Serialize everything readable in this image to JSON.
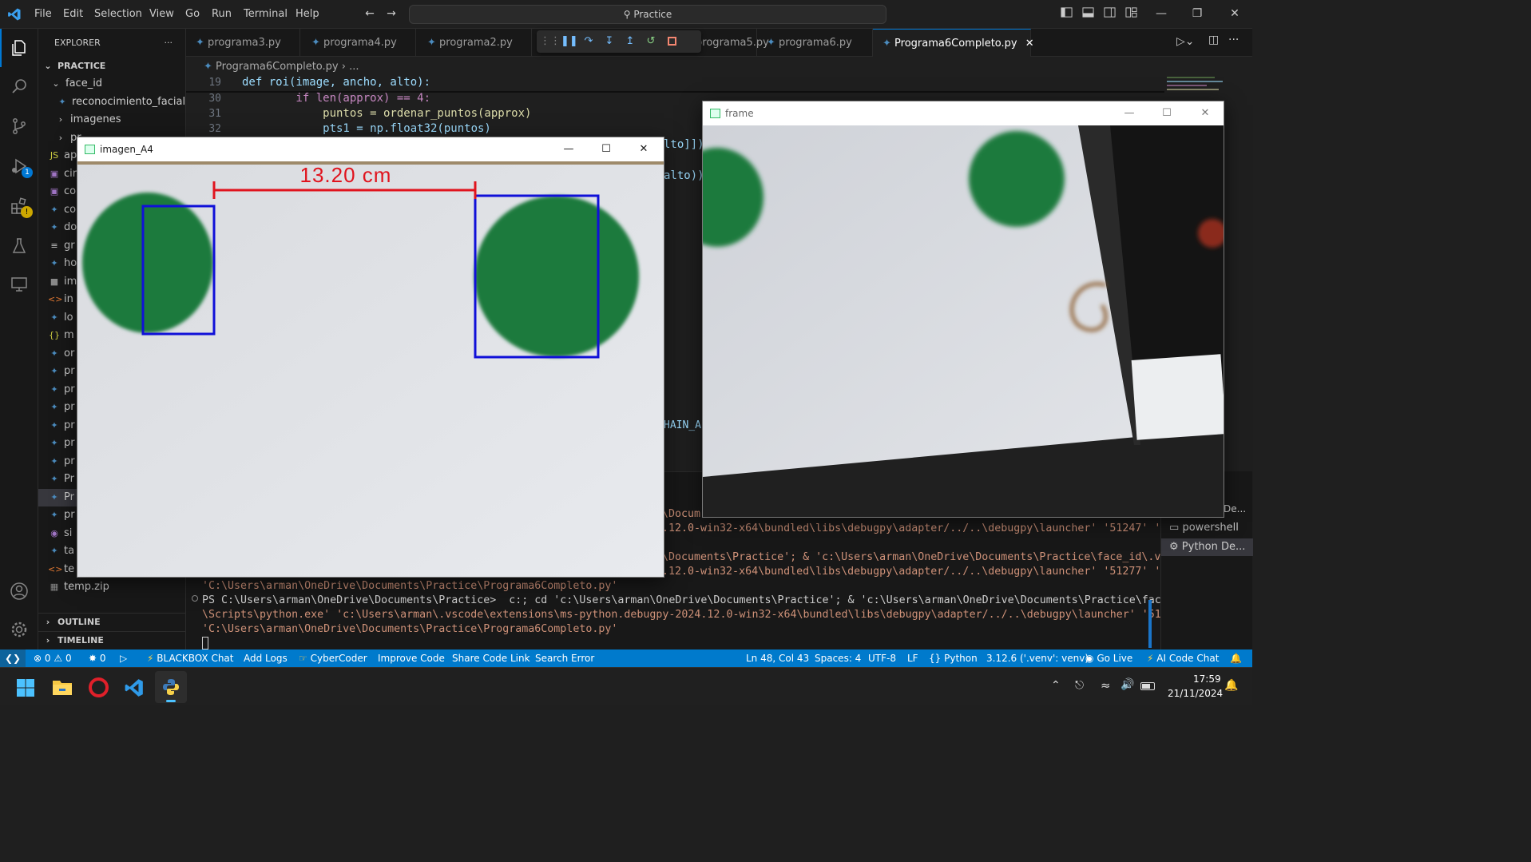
{
  "titlebar": {
    "menu": [
      "File",
      "Edit",
      "Selection",
      "View",
      "Go",
      "Run",
      "Terminal",
      "Help"
    ],
    "search_text": "Practice"
  },
  "explorer": {
    "header": "EXPLORER",
    "root": "PRACTICE",
    "items": [
      {
        "label": "face_id",
        "kind": "folder-open"
      },
      {
        "label": "reconocimiento_facial....",
        "kind": "py"
      },
      {
        "label": "imagenes",
        "kind": "folder"
      },
      {
        "label": "pr",
        "kind": "folder"
      },
      {
        "label": "ap",
        "kind": "js"
      },
      {
        "label": "cir",
        "kind": "img"
      },
      {
        "label": "co",
        "kind": "img"
      },
      {
        "label": "co",
        "kind": "py"
      },
      {
        "label": "do",
        "kind": "py"
      },
      {
        "label": "gr",
        "kind": "txt"
      },
      {
        "label": "ho",
        "kind": "py"
      },
      {
        "label": "im",
        "kind": "file"
      },
      {
        "label": "in",
        "kind": "html"
      },
      {
        "label": "lo",
        "kind": "py"
      },
      {
        "label": "m",
        "kind": "json"
      },
      {
        "label": "or",
        "kind": "py"
      },
      {
        "label": "pr",
        "kind": "py"
      },
      {
        "label": "pr",
        "kind": "py"
      },
      {
        "label": "pr",
        "kind": "py"
      },
      {
        "label": "pr",
        "kind": "py"
      },
      {
        "label": "pr",
        "kind": "py"
      },
      {
        "label": "pr",
        "kind": "py"
      },
      {
        "label": "Pr",
        "kind": "py"
      },
      {
        "label": "Pr",
        "kind": "py"
      },
      {
        "label": "pr",
        "kind": "py"
      },
      {
        "label": "si",
        "kind": "git"
      },
      {
        "label": "ta",
        "kind": "py"
      },
      {
        "label": "te",
        "kind": "html"
      },
      {
        "label": "temp.zip",
        "kind": "zip"
      }
    ],
    "outline": "OUTLINE",
    "timeline": "TIMELINE"
  },
  "tabs": [
    "programa3.py",
    "programa4.py",
    "programa2.py",
    "programa5.py",
    "programa6.py",
    "Programa6Completo.py"
  ],
  "breadcrumb": {
    "file": "Programa6Completo.py",
    "rest": "..."
  },
  "code": [
    {
      "num": "19",
      "text": "def roi(image, ancho, alto):"
    },
    {
      "num": "30",
      "text": "        if len(approx) == 4:"
    },
    {
      "num": "31",
      "text": "            puntos = ordenar_puntos(approx)"
    },
    {
      "num": "32",
      "text": "            pts1 = np.float32(puntos)"
    }
  ],
  "code_fragments": {
    "f1": "lto]])",
    "f2": "alto))",
    "f3": "HAIN_A"
  },
  "terminal": {
    "lines": [
      "\\Docum",
      ".12.0-win32-x64\\bundled\\libs\\debugpy\\adapter/../..\\debugpy\\launcher' '51247' '--'",
      "\\Documents\\Practice'; & 'c:\\Users\\arman\\OneDrive\\Documents\\Practice\\face_id\\.venv",
      ".12.0-win32-x64\\bundled\\libs\\debugpy\\adapter/../..\\debugpy\\launcher' '51277' '--'",
      "'C:\\Users\\arman\\OneDrive\\Documents\\Practice\\Programa6Completo.py'",
      "PS C:\\Users\\arman\\OneDrive\\Documents\\Practice>  c:; cd 'c:\\Users\\arman\\OneDrive\\Documents\\Practice'; & 'c:\\Users\\arman\\OneDrive\\Documents\\Practice\\face_id\\.venv",
      "\\Scripts\\python.exe' 'c:\\Users\\arman\\.vscode\\extensions\\ms-python.debugpy-2024.12.0-win32-x64\\bundled\\libs\\debugpy\\adapter/../..\\debugpy\\launcher' '51292' '--'",
      "'C:\\Users\\arman\\OneDrive\\Documents\\Practice\\Programa6Completo.py'"
    ],
    "sessions": [
      "De...",
      "powershell",
      "Python De..."
    ]
  },
  "window_imagen": {
    "title": "imagen_A4",
    "measurement": "13.20 cm"
  },
  "window_frame": {
    "title": "frame"
  },
  "statusbar": {
    "errors": "0",
    "warnings": "0",
    "ports": "0",
    "left_items": [
      "BLACKBOX Chat",
      "Add Logs",
      "CyberCoder",
      "Improve Code",
      "Share Code Link",
      "Search Error"
    ],
    "position": "Ln 48, Col 43",
    "spaces": "Spaces: 4",
    "encoding": "UTF-8",
    "eol": "LF",
    "language": "Python",
    "interpreter": "3.12.6 ('.venv': venv)",
    "golive": "Go Live",
    "aichat": "AI Code Chat"
  },
  "taskbar": {
    "time": "17:59",
    "date": "21/11/2024"
  },
  "badges": {
    "debug": "1"
  },
  "colors": {
    "accent": "#007acc",
    "measure_line": "#e0141e",
    "box": "#1010d8",
    "circle": "#1f7a3e"
  }
}
